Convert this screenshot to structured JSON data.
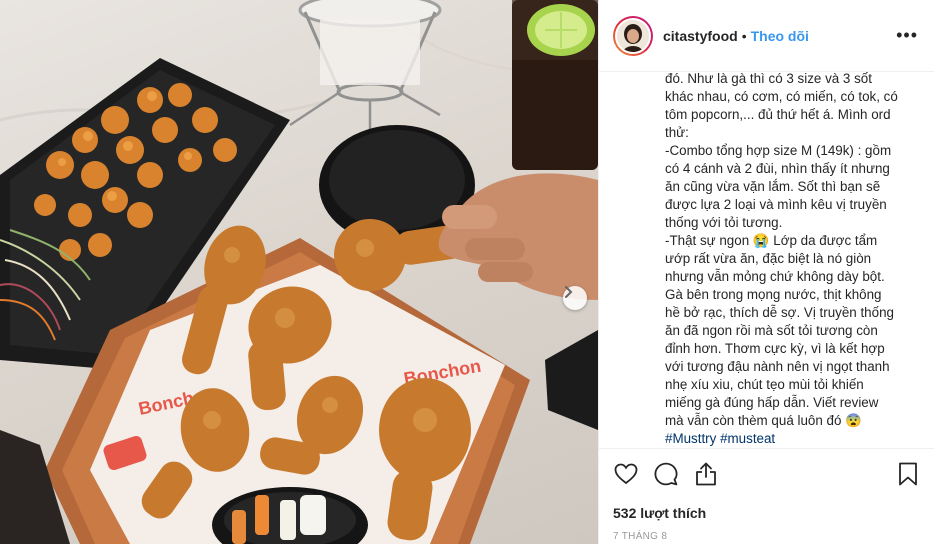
{
  "post": {
    "username": "citastyfood",
    "separator": "•",
    "follow_label": "Theo dõi",
    "more_label": "•••",
    "caption_lines": [
      "đó. Như là gà thì có 3 size và 3 sốt",
      "khác nhau, có cơm, có miến, có tok, có",
      "tôm popcorn,... đủ thứ hết á. Mình ord",
      "thử:",
      "-Combo tổng hợp size M (149k) : gồm",
      "có 4 cánh và 2 đùi, nhìn thấy ít nhưng",
      "ăn cũng vừa vặn lắm. Sốt thì bạn sẽ",
      "được lựa 2 loại và mình kêu vị truyền",
      "thống với tỏi tương.",
      "-Thật sự ngon 😭 Lớp da được tẩm",
      "ướp rất vừa ăn, đặc biệt là nó giòn",
      "nhưng vẫn mỏng chứ không dày bột.",
      "Gà bên trong mọng nước, thịt không",
      "hề bở rạc, thích dễ sợ. Vị truyền thống",
      "ăn đã ngon rồi mà sốt tỏi tương còn",
      "đỉnh hơn. Thơm cực kỳ, vì là kết hợp",
      "với tương đậu nành nên vị ngọt thanh",
      "nhẹ xíu xiu, chút tẹo mùi tỏi khiến",
      "miếng gà đúng hấp dẫn. Viết review",
      "mà vẫn còn thèm quá luôn đó 😨"
    ],
    "hashtags": [
      "#Musttry",
      "#musteat"
    ],
    "likes": "532 lượt thích",
    "date": "7 THÁNG 8"
  },
  "photo": {
    "sign_text": "Bonchon"
  },
  "icons": {
    "like": "heart-icon",
    "comment": "comment-icon",
    "share": "share-icon",
    "save": "bookmark-icon",
    "next": "chevron-right-icon"
  },
  "colors": {
    "follow": "#3897f0",
    "hashtag": "#003569",
    "text": "#262626",
    "meta": "#999999"
  }
}
